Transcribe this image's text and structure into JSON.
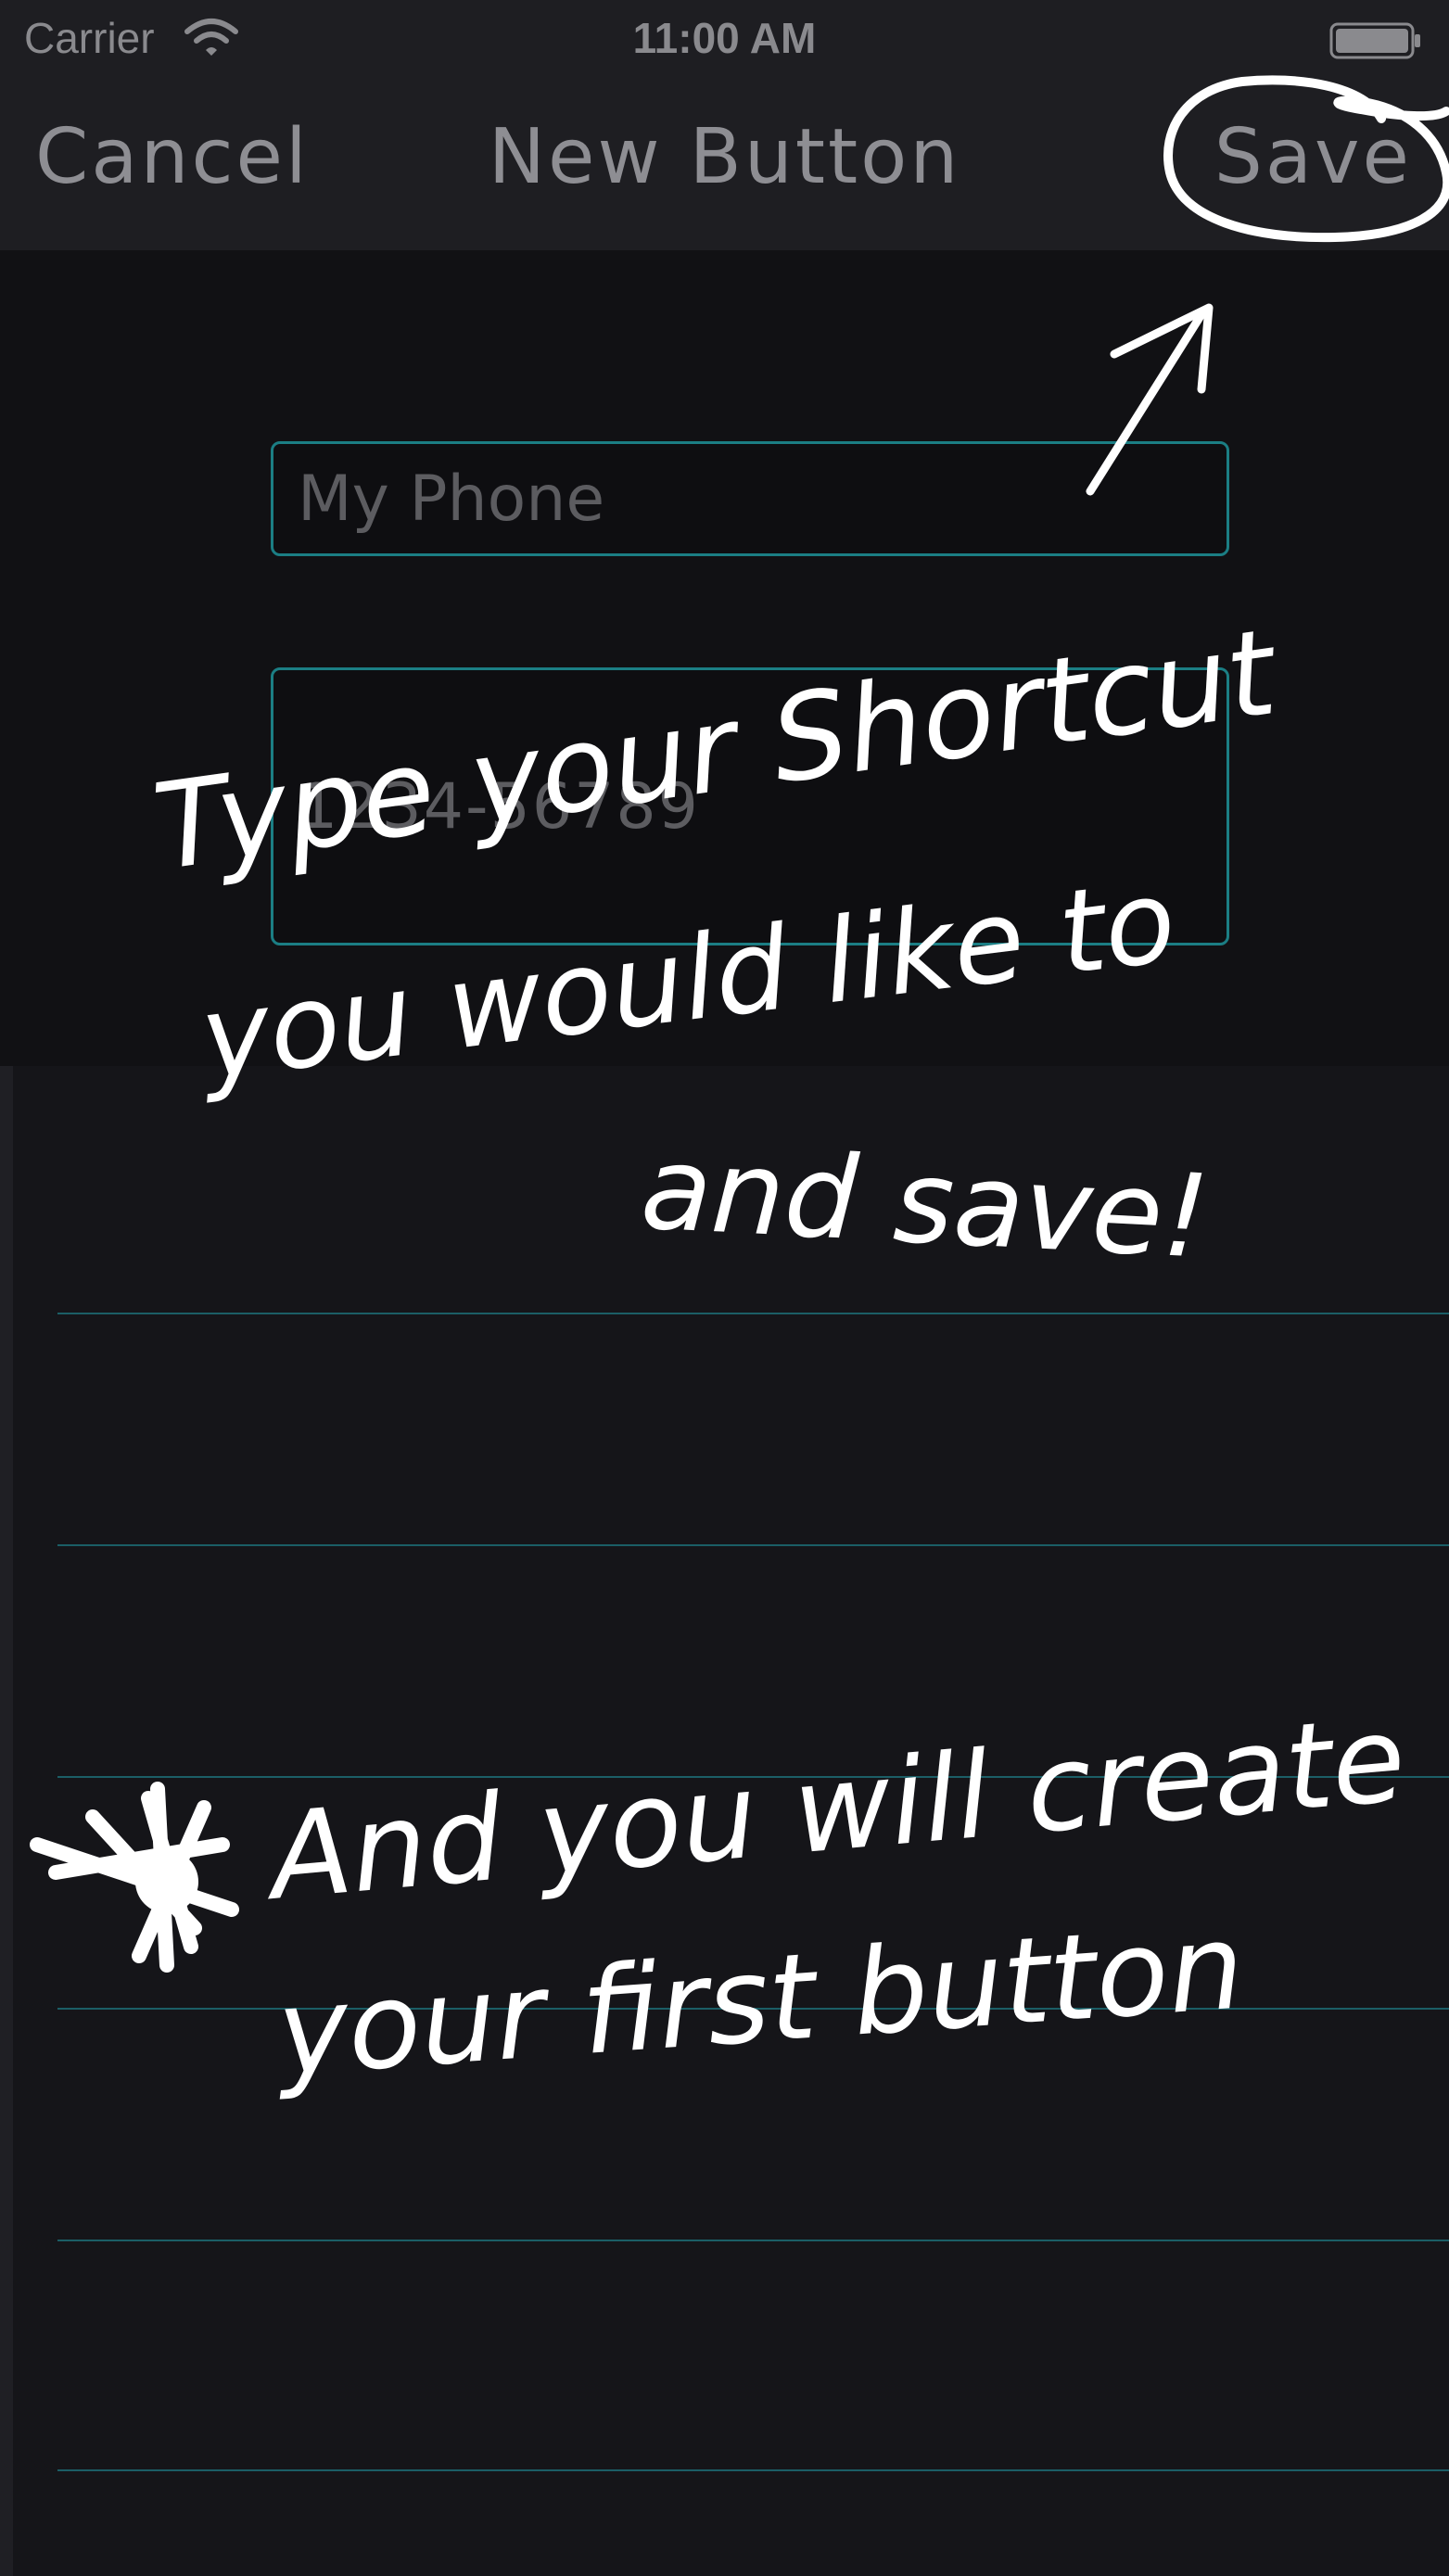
{
  "status_bar": {
    "carrier": "Carrier",
    "time": "11:00 AM",
    "wifi_icon": "wifi-icon",
    "battery_icon": "battery-icon"
  },
  "nav_bar": {
    "cancel_label": "Cancel",
    "title": "New Button",
    "save_label": "Save"
  },
  "form": {
    "name_placeholder": "My Phone",
    "number_placeholder": "1234-56789"
  },
  "annotations": {
    "hint_line_1": "Type your Shortcut",
    "hint_line_2": "you would like to",
    "hint_line_3": "and save!",
    "create_line_1": "And you will create",
    "create_line_2": "your first button",
    "arrow_icon": "arrow-up-right-icon",
    "circle_icon": "circle-highlight-icon",
    "star_icon": "star-burst-icon"
  },
  "colors": {
    "background": "#151519",
    "bar": "#1e1e22",
    "panel": "#111114",
    "accent": "#1b7e84",
    "rule": "#1b5e66",
    "nav_text": "#8e8e93",
    "annotation": "#ffffff"
  }
}
